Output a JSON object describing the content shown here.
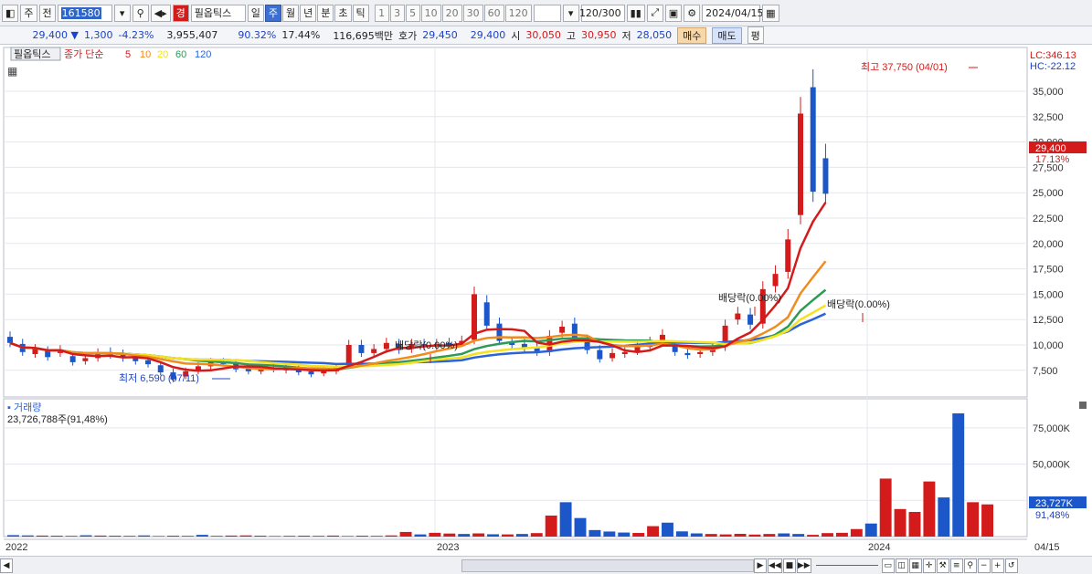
{
  "toolbar": {
    "period_label": "주",
    "prev_label": "전",
    "code": "161580",
    "search_icon": "search-icon",
    "stock_type_badge": "경",
    "stock_name": "필옵틱스",
    "intervals": [
      "일",
      "주",
      "월",
      "년",
      "분",
      "초",
      "틱"
    ],
    "selected_interval": "주",
    "minute_units": [
      "1",
      "3",
      "5",
      "10",
      "20",
      "30",
      "60",
      "120"
    ],
    "count": "120",
    "count_max": "/300",
    "date": "2024/04/15"
  },
  "quote": {
    "price": "29,400",
    "change": "1,300",
    "change_pct": "-4.23%",
    "volume": "3,955,407",
    "vol_ratio": "90.32%",
    "turnover": "17.44%",
    "amount": "116,695백만",
    "ask_label": "호가",
    "ask1": "29,450",
    "ask2": "29,400",
    "open_label": "시",
    "open": "30,050",
    "high_label": "고",
    "high": "30,950",
    "low_label": "저",
    "low": "28,050",
    "buy_btn": "매수",
    "sell_btn": "매도",
    "eval_btn": "평"
  },
  "legend": {
    "stock": "필옵틱스",
    "ma_label": "종가 단순",
    "mas": [
      "5",
      "10",
      "20",
      "60",
      "120"
    ],
    "ma_colors": [
      "#d41b1b",
      "#f08c1e",
      "#f5e11e",
      "#2d9a55",
      "#2d63d8"
    ]
  },
  "indicators": {
    "lc": "LC:346.13",
    "hc": "HC:-22.12",
    "price_tag": "29,400",
    "pct_tag": "17.13%"
  },
  "annotations": {
    "high": "최고 37,750 (04/01)",
    "low": "최저 6,590 (07/11)",
    "dividends": [
      "배당락(0.00%)",
      "배당락(0.00%)",
      "배당락(0.00%)"
    ]
  },
  "volume_panel": {
    "title": "거래량",
    "value": "23,726,788주(91,48%)",
    "tag": "23,727K",
    "pct": "91,48%",
    "ticks": [
      "75,000K",
      "50,000K",
      "25,000K"
    ]
  },
  "axis": {
    "y_ticks": [
      "35,000",
      "32,500",
      "30,000",
      "27,500",
      "25,000",
      "22,500",
      "20,000",
      "17,500",
      "15,000",
      "12,500",
      "10,000",
      "7,500"
    ],
    "x_ticks": [
      "2022",
      "2023",
      "2024"
    ],
    "last_date": "04/15"
  },
  "chart_data": {
    "type": "candlestick",
    "series_name": "필옵틱스",
    "period": "weekly",
    "ylim": [
      6000,
      38000
    ],
    "x_range": [
      "2022",
      "2024/04/15"
    ],
    "candles_approx": [
      [
        10800,
        10200
      ],
      [
        10100,
        9300
      ],
      [
        9100,
        9600
      ],
      [
        9400,
        8800
      ],
      [
        9200,
        9500
      ],
      [
        8900,
        8300
      ],
      [
        8400,
        8700
      ],
      [
        8700,
        9200
      ],
      [
        9300,
        9000
      ],
      [
        9100,
        8700
      ],
      [
        8700,
        8400
      ],
      [
        8500,
        8100
      ],
      [
        8000,
        7300
      ],
      [
        7300,
        6600
      ],
      [
        6900,
        7400
      ],
      [
        7400,
        7900
      ],
      [
        7900,
        8300
      ],
      [
        8300,
        8200
      ],
      [
        8200,
        7600
      ],
      [
        7700,
        7400
      ],
      [
        7400,
        7700
      ],
      [
        7800,
        7600
      ],
      [
        7500,
        7900
      ],
      [
        7700,
        7300
      ],
      [
        7400,
        7100
      ],
      [
        7200,
        7500
      ],
      [
        7400,
        7800
      ],
      [
        8000,
        10000
      ],
      [
        10000,
        9200
      ],
      [
        9200,
        9600
      ],
      [
        9600,
        10200
      ],
      [
        10100,
        9500
      ],
      [
        9600,
        10100
      ],
      [
        10100,
        9900
      ],
      [
        9900,
        10100
      ],
      [
        10200,
        10100
      ],
      [
        10200,
        10400
      ],
      [
        10500,
        15000
      ],
      [
        14200,
        11900
      ],
      [
        12100,
        10400
      ],
      [
        10300,
        10000
      ],
      [
        10100,
        9600
      ],
      [
        9700,
        9300
      ],
      [
        9300,
        10900
      ],
      [
        11200,
        11800
      ],
      [
        12100,
        10700
      ],
      [
        10500,
        9500
      ],
      [
        9500,
        8600
      ],
      [
        8700,
        9200
      ],
      [
        9100,
        9300
      ],
      [
        9400,
        9900
      ],
      [
        9800,
        10300
      ],
      [
        10400,
        11000
      ],
      [
        9900,
        9300
      ],
      [
        9200,
        9000
      ],
      [
        9100,
        9300
      ],
      [
        9300,
        9800
      ],
      [
        9800,
        11900
      ],
      [
        12500,
        13100
      ],
      [
        13000,
        12000
      ],
      [
        12100,
        15500
      ],
      [
        15800,
        17000
      ],
      [
        17200,
        20400
      ],
      [
        22800,
        32800
      ],
      [
        35400,
        25100
      ],
      [
        28400,
        24900
      ]
    ],
    "ma_colors": {
      "ma5": "#d41b1b",
      "ma10": "#f08c1e",
      "ma20": "#f5e11e",
      "ma60": "#2d9a55",
      "ma120": "#2d63d8"
    },
    "volume_approx_K": [
      1000,
      800,
      700,
      600,
      500,
      900,
      700,
      600,
      500,
      800,
      400,
      600,
      500,
      1200,
      500,
      700,
      800,
      600,
      400,
      500,
      600,
      500,
      700,
      400,
      600,
      500,
      800,
      3200,
      1500,
      2600,
      2100,
      1800,
      2200,
      1600,
      1500,
      1800,
      2400,
      14500,
      23700,
      12800,
      4500,
      3500,
      2800,
      2500,
      7200,
      9600,
      3600,
      2200,
      1800,
      1500,
      1900,
      1400,
      1800,
      2200,
      1800,
      1200,
      2400,
      2600,
      5200,
      9000,
      40000,
      19000,
      17000,
      38000,
      27000,
      85000,
      23700,
      22200
    ]
  }
}
